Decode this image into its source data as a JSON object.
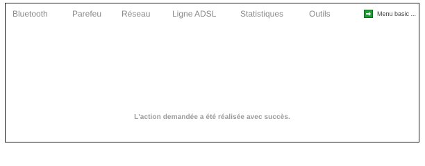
{
  "nav": {
    "items": [
      {
        "label": "Bluetooth"
      },
      {
        "label": "Parefeu"
      },
      {
        "label": "Réseau"
      },
      {
        "label": "Ligne ADSL"
      },
      {
        "label": "Statistiques"
      },
      {
        "label": "Outils"
      }
    ],
    "menu_basic": {
      "label": "Menu basic ...",
      "icon": "arrow-right-icon"
    }
  },
  "main": {
    "message": "L'action demandée a été réalisée avec succès."
  },
  "colors": {
    "border": "#1a1a1a",
    "nav_text": "#8a8a8a",
    "message_text": "#9a9a9a",
    "icon_green": "#1f9a34"
  }
}
